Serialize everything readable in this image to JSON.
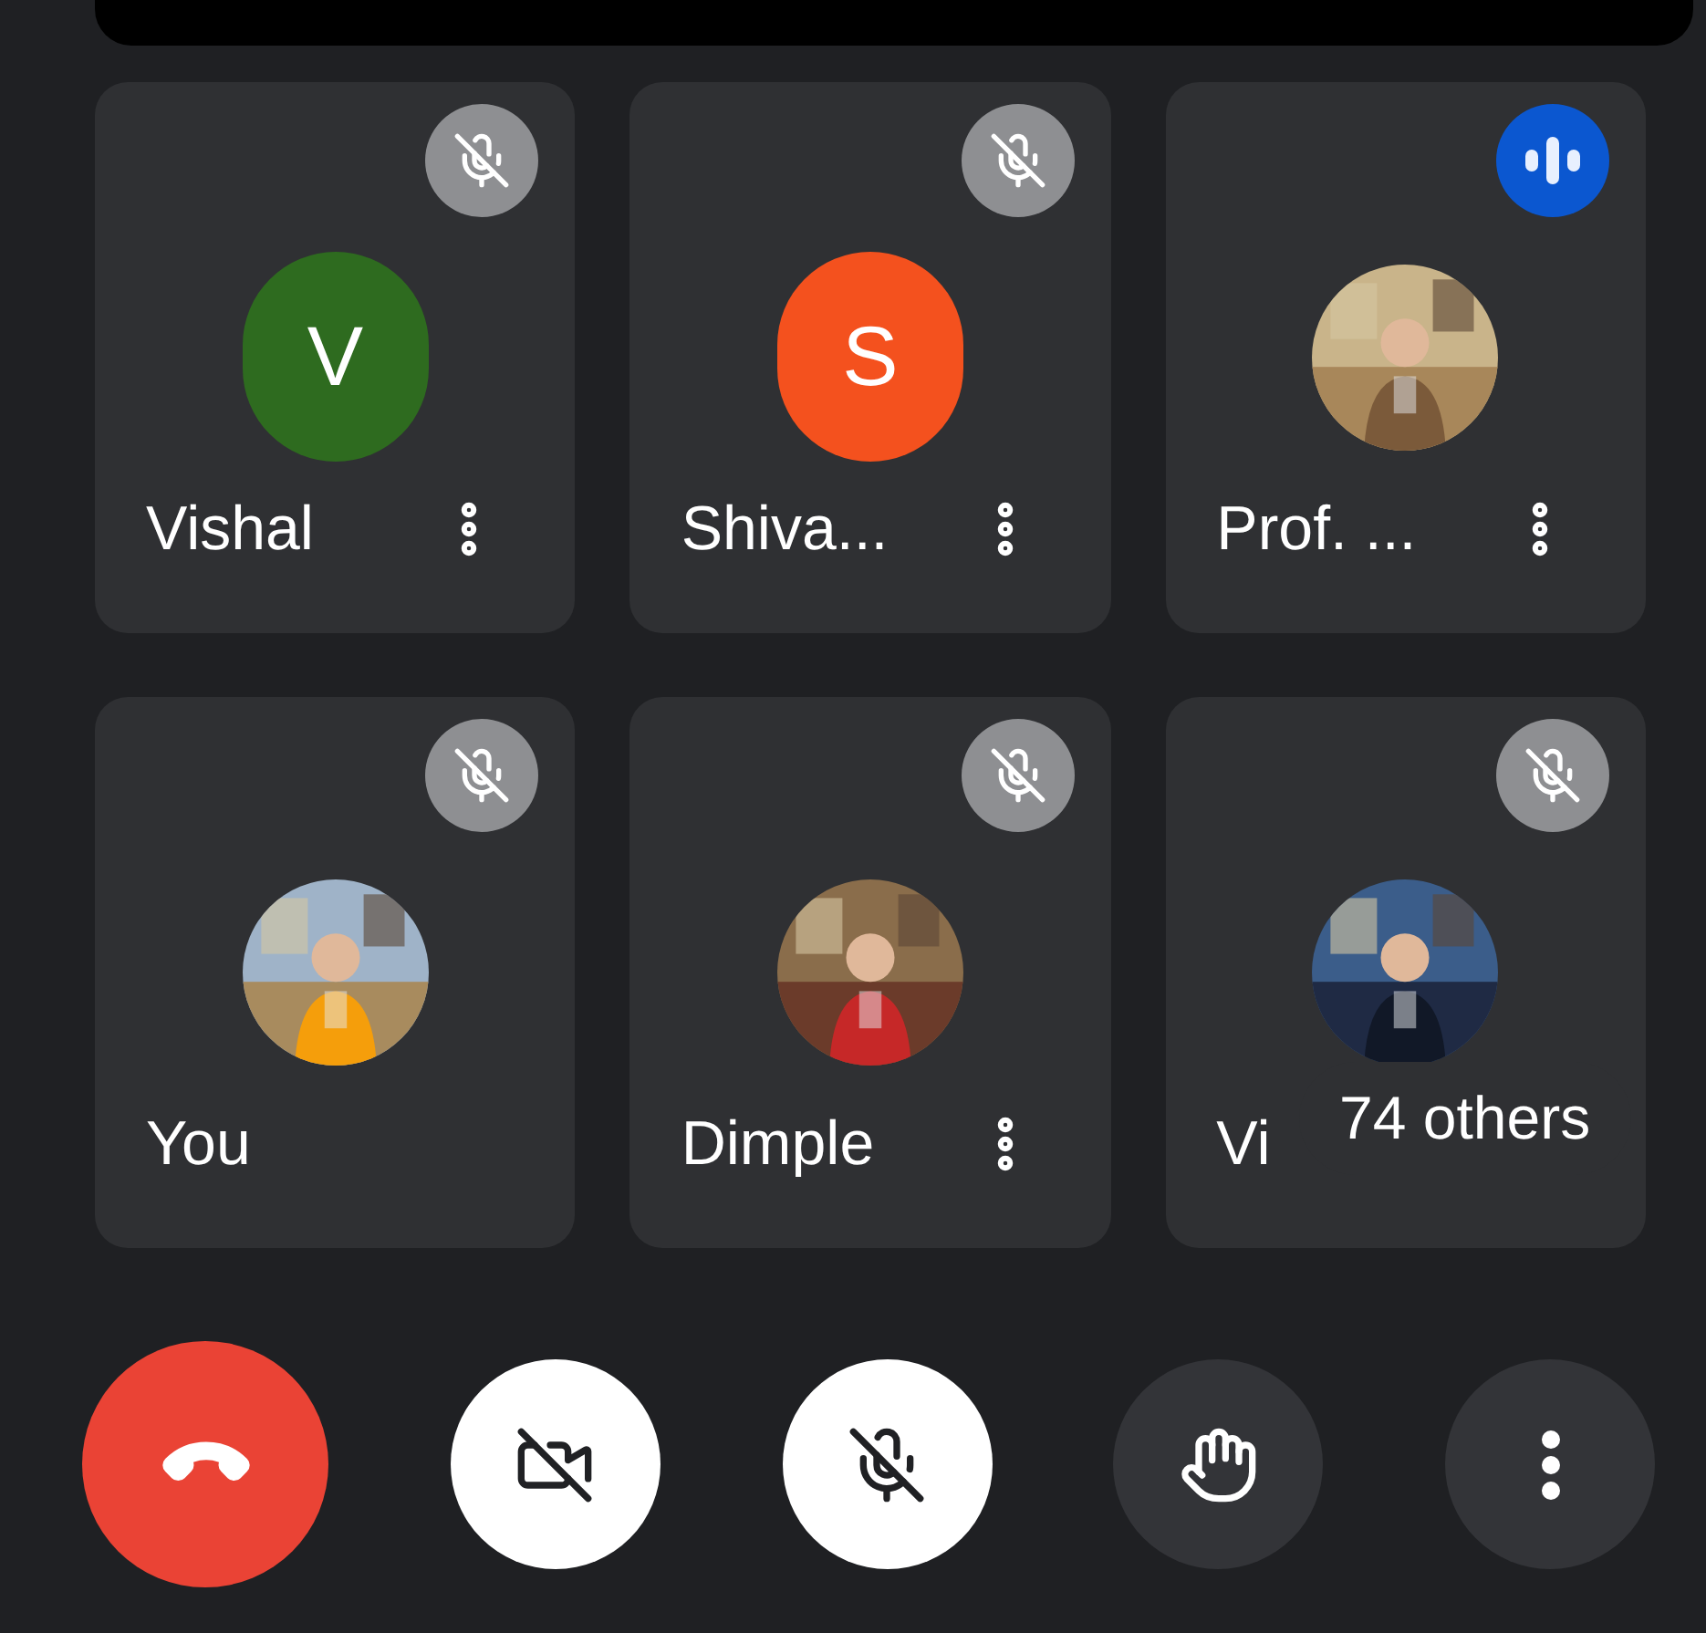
{
  "participants": [
    {
      "name": "Vishal",
      "avatar": {
        "kind": "initial",
        "letter": "V",
        "color": "#2e6b1f"
      },
      "muted": true,
      "speaking": false,
      "menu": true
    },
    {
      "name": "Shiva...",
      "avatar": {
        "kind": "initial",
        "letter": "S",
        "color": "#f4511e"
      },
      "muted": true,
      "speaking": false,
      "menu": true
    },
    {
      "name": "Prof. ...",
      "muted": false,
      "speaking": true,
      "menu": true
    },
    {
      "name": "You",
      "muted": true,
      "speaking": false,
      "menu": false
    },
    {
      "name": "Dimple",
      "muted": true,
      "speaking": false,
      "menu": true
    },
    {
      "name": "Vi",
      "muted": true,
      "speaking": false,
      "menu": false
    }
  ],
  "overflow": {
    "label": "74 others"
  },
  "controls": {
    "camera_on": false,
    "mic_on": false
  }
}
